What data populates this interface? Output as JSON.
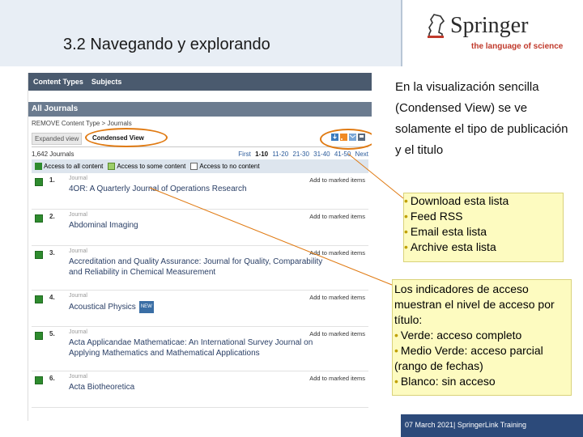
{
  "slide": {
    "title": "3.2 Navegando y explorando",
    "logo_name": "Springer",
    "logo_tagline": "the language of science",
    "footer_date": "07 March 2021",
    "footer_sep": "|",
    "footer_label": "SpringerLink Training"
  },
  "screenshot": {
    "nav": [
      "Content Types",
      "Subjects"
    ],
    "section": "All Journals",
    "remove_line": "REMOVE Content Type > Journals",
    "tabs": {
      "expanded": "Expanded view",
      "condensed": "Condensed View"
    },
    "count": "1,642 Journals",
    "pages": [
      "First",
      "1-10",
      "11-20",
      "21-30",
      "31-40",
      "41-50",
      "Next"
    ],
    "access": {
      "all": "Access to all content",
      "some": "Access to some content",
      "none": "Access to no content"
    },
    "tool_icons": [
      "download-list-icon",
      "rss-feed-icon",
      "email-list-icon",
      "archive-list-icon"
    ],
    "mark_label": "Add to marked items",
    "new_badge": "NEW",
    "journals": [
      {
        "num": "1.",
        "type": "Journal",
        "title": "4OR: A Quarterly Journal of Operations Research",
        "access": "full",
        "is_new": false
      },
      {
        "num": "2.",
        "type": "Journal",
        "title": "Abdominal Imaging",
        "access": "full",
        "is_new": false
      },
      {
        "num": "3.",
        "type": "Journal",
        "title": "Accreditation and Quality Assurance: Journal for Quality, Comparability and Reliability in Chemical Measurement",
        "access": "full",
        "is_new": false
      },
      {
        "num": "4.",
        "type": "Journal",
        "title": "Acoustical Physics",
        "access": "full",
        "is_new": true
      },
      {
        "num": "5.",
        "type": "Journal",
        "title": "Acta Applicandae Mathematicae: An International Survey Journal on Applying Mathematics and Mathematical Applications",
        "access": "full",
        "is_new": false
      },
      {
        "num": "6.",
        "type": "Journal",
        "title": "Acta Biotheoretica",
        "access": "full",
        "is_new": false
      }
    ]
  },
  "notes": {
    "description": "En la visualización sencilla (Condensed View) se ve solamente el tipo de publicación y el titulo",
    "tools_list": [
      "Download esta lista",
      "Feed RSS",
      "Email esta lista",
      "Archive esta lista"
    ],
    "indicators_intro": "Los indicadores de acceso muestran el nivel de acceso por título:",
    "indicators": [
      "Verde: acceso completo",
      "Medio Verde: acceso parcial (rango de fechas)",
      "Blanco: sin acceso"
    ],
    "bullet": "•"
  },
  "colors": {
    "accent_orange": "#e07a12",
    "access_full": "#2e8b2e",
    "access_some": "#9dcf6a",
    "callout_bg": "#fdfbc0",
    "footer_bg": "#2c4a7a"
  }
}
